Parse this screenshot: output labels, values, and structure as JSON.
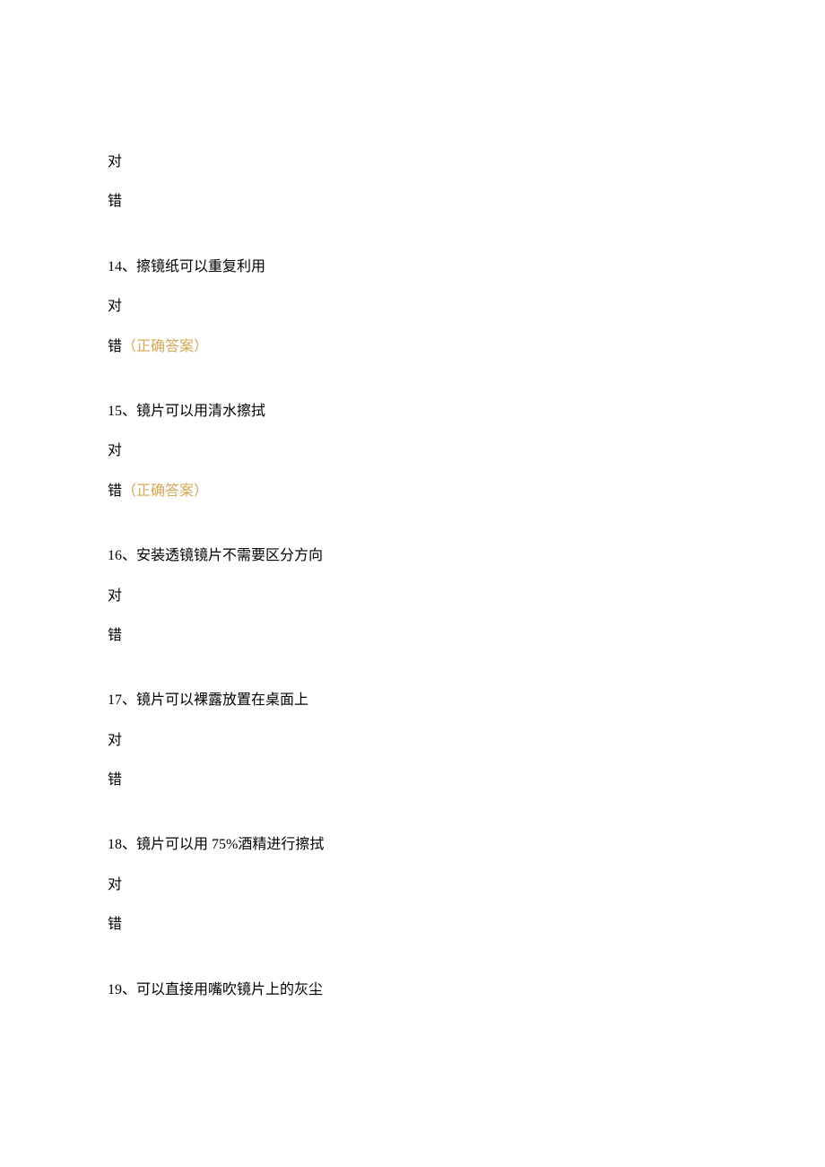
{
  "orphan_answers": {
    "true": "对",
    "false": "错"
  },
  "correct_label": "（正确答案）",
  "questions": [
    {
      "number": "14、",
      "text": "擦镜纸可以重复利用",
      "opt_true": "对",
      "opt_false": "错",
      "show_correct_on_false": true
    },
    {
      "number": "15、",
      "text": "镜片可以用清水擦拭",
      "opt_true": "对",
      "opt_false": "错",
      "show_correct_on_false": true
    },
    {
      "number": "16、",
      "text": "安装透镜镜片不需要区分方向",
      "opt_true": "对",
      "opt_false": "错",
      "show_correct_on_false": false
    },
    {
      "number": "17、",
      "text": "镜片可以裸露放置在桌面上",
      "opt_true": "对",
      "opt_false": "错",
      "show_correct_on_false": false
    },
    {
      "number": "18、",
      "text": "镜片可以用 75%酒精进行擦拭",
      "opt_true": "对",
      "opt_false": "错",
      "show_correct_on_false": false
    },
    {
      "number": "19、",
      "text": "可以直接用嘴吹镜片上的灰尘",
      "opt_true": "",
      "opt_false": "",
      "show_correct_on_false": false,
      "no_options": true
    }
  ]
}
